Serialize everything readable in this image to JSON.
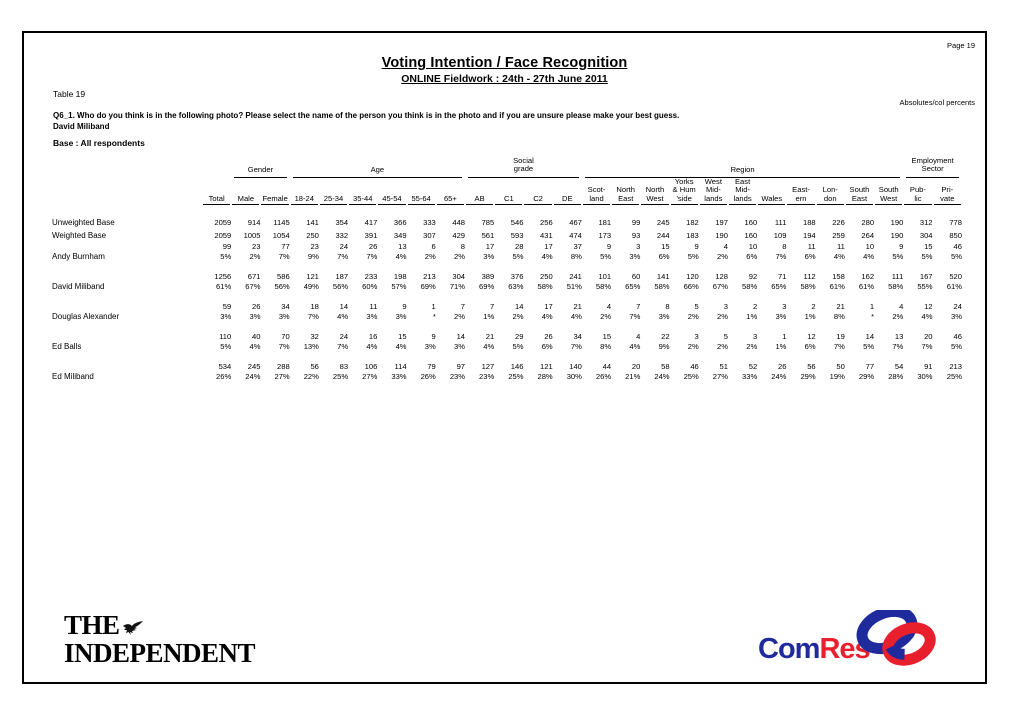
{
  "page": {
    "page_number": "Page 19",
    "notes": "Absolutes/col percents",
    "title": "Voting Intention / Face Recognition",
    "subtitle": "ONLINE Fieldwork : 24th - 27th June 2011",
    "table_label": "Table 19",
    "question": "Q6_1. Who do you think is in the following photo? Please select the name of the person you think is in the photo and if you are unsure please make your best guess.",
    "question_subject": "David Miliband",
    "base": "Base : All respondents"
  },
  "logos": {
    "independent_line1": "THE",
    "independent_line2": "INDEPENDENT",
    "comres_com": "Com",
    "comres_res": "Res",
    "comres_blue": "#1f2a9c",
    "comres_red": "#e8202e"
  },
  "table": {
    "groups": [
      {
        "label": "",
        "span": 1
      },
      {
        "label": "Gender",
        "span": 2
      },
      {
        "label": "Age",
        "span": 6
      },
      {
        "label": "Social grade",
        "span": 4
      },
      {
        "label": "Region",
        "span": 11
      },
      {
        "label": "Employment Sector",
        "span": 2
      }
    ],
    "columns": [
      {
        "id": "total",
        "l1": "",
        "l2": "",
        "l3": "Total"
      },
      {
        "id": "male",
        "l1": "",
        "l2": "",
        "l3": "Male"
      },
      {
        "id": "female",
        "l1": "",
        "l2": "",
        "l3": "Female"
      },
      {
        "id": "a1824",
        "l1": "",
        "l2": "",
        "l3": "18-24"
      },
      {
        "id": "a2534",
        "l1": "",
        "l2": "",
        "l3": "25-34"
      },
      {
        "id": "a3544",
        "l1": "",
        "l2": "",
        "l3": "35-44"
      },
      {
        "id": "a4554",
        "l1": "",
        "l2": "",
        "l3": "45-54"
      },
      {
        "id": "a5564",
        "l1": "",
        "l2": "",
        "l3": "55-64"
      },
      {
        "id": "a65",
        "l1": "",
        "l2": "",
        "l3": "65+"
      },
      {
        "id": "ab",
        "l1": "",
        "l2": "",
        "l3": "AB"
      },
      {
        "id": "c1",
        "l1": "",
        "l2": "",
        "l3": "C1"
      },
      {
        "id": "c2",
        "l1": "",
        "l2": "",
        "l3": "C2"
      },
      {
        "id": "de",
        "l1": "",
        "l2": "",
        "l3": "DE"
      },
      {
        "id": "scot",
        "l1": "",
        "l2": "Scot-",
        "l3": "land"
      },
      {
        "id": "ne",
        "l1": "",
        "l2": "North",
        "l3": "East"
      },
      {
        "id": "nw",
        "l1": "",
        "l2": "North",
        "l3": "West"
      },
      {
        "id": "yorks",
        "l1": "Yorks",
        "l2": "& Hum",
        "l3": "'side"
      },
      {
        "id": "wmid",
        "l1": "West",
        "l2": "Mid-",
        "l3": "lands"
      },
      {
        "id": "emid",
        "l1": "East",
        "l2": "Mid-",
        "l3": "lands"
      },
      {
        "id": "wales",
        "l1": "",
        "l2": "",
        "l3": "Wales"
      },
      {
        "id": "eastern",
        "l1": "",
        "l2": "East-",
        "l3": "ern"
      },
      {
        "id": "london",
        "l1": "",
        "l2": "Lon-",
        "l3": "don"
      },
      {
        "id": "se",
        "l1": "",
        "l2": "South",
        "l3": "East"
      },
      {
        "id": "sw",
        "l1": "",
        "l2": "South",
        "l3": "West"
      },
      {
        "id": "public",
        "l1": "",
        "l2": "Pub-",
        "l3": "lic"
      },
      {
        "id": "private",
        "l1": "",
        "l2": "Pri-",
        "l3": "vate"
      }
    ],
    "rows": [
      {
        "label": "Unweighted Base",
        "type": "base",
        "counts": [
          "2059",
          "914",
          "1145",
          "141",
          "354",
          "417",
          "366",
          "333",
          "448",
          "785",
          "546",
          "256",
          "467",
          "181",
          "99",
          "245",
          "182",
          "197",
          "160",
          "111",
          "188",
          "226",
          "280",
          "190",
          "312",
          "778"
        ]
      },
      {
        "label": "Weighted Base",
        "type": "base",
        "counts": [
          "2059",
          "1005",
          "1054",
          "250",
          "332",
          "391",
          "349",
          "307",
          "429",
          "561",
          "593",
          "431",
          "474",
          "173",
          "93",
          "244",
          "183",
          "190",
          "160",
          "109",
          "194",
          "259",
          "264",
          "190",
          "304",
          "850"
        ]
      },
      {
        "label": "Andy Burnham",
        "type": "data",
        "counts": [
          "99",
          "23",
          "77",
          "23",
          "24",
          "26",
          "13",
          "6",
          "8",
          "17",
          "28",
          "17",
          "37",
          "9",
          "3",
          "15",
          "9",
          "4",
          "10",
          "8",
          "11",
          "11",
          "10",
          "9",
          "15",
          "46"
        ],
        "pcts": [
          "5%",
          "2%",
          "7%",
          "9%",
          "7%",
          "7%",
          "4%",
          "2%",
          "2%",
          "3%",
          "5%",
          "4%",
          "8%",
          "5%",
          "3%",
          "6%",
          "5%",
          "2%",
          "6%",
          "7%",
          "6%",
          "4%",
          "4%",
          "5%",
          "5%",
          "5%"
        ]
      },
      {
        "label": "David Miliband",
        "type": "data",
        "counts": [
          "1256",
          "671",
          "586",
          "121",
          "187",
          "233",
          "198",
          "213",
          "304",
          "389",
          "376",
          "250",
          "241",
          "101",
          "60",
          "141",
          "120",
          "128",
          "92",
          "71",
          "112",
          "158",
          "162",
          "111",
          "167",
          "520"
        ],
        "pcts": [
          "61%",
          "67%",
          "56%",
          "49%",
          "56%",
          "60%",
          "57%",
          "69%",
          "71%",
          "69%",
          "63%",
          "58%",
          "51%",
          "58%",
          "65%",
          "58%",
          "66%",
          "67%",
          "58%",
          "65%",
          "58%",
          "61%",
          "61%",
          "58%",
          "55%",
          "61%"
        ]
      },
      {
        "label": "Douglas Alexander",
        "type": "data",
        "counts": [
          "59",
          "26",
          "34",
          "18",
          "14",
          "11",
          "9",
          "1",
          "7",
          "7",
          "14",
          "17",
          "21",
          "4",
          "7",
          "8",
          "5",
          "3",
          "2",
          "3",
          "2",
          "21",
          "1",
          "4",
          "12",
          "24"
        ],
        "pcts": [
          "3%",
          "3%",
          "3%",
          "7%",
          "4%",
          "3%",
          "3%",
          "*",
          "2%",
          "1%",
          "2%",
          "4%",
          "4%",
          "2%",
          "7%",
          "3%",
          "2%",
          "2%",
          "1%",
          "3%",
          "1%",
          "8%",
          "*",
          "2%",
          "4%",
          "3%"
        ]
      },
      {
        "label": "Ed Balls",
        "type": "data",
        "counts": [
          "110",
          "40",
          "70",
          "32",
          "24",
          "16",
          "15",
          "9",
          "14",
          "21",
          "29",
          "26",
          "34",
          "15",
          "4",
          "22",
          "3",
          "5",
          "3",
          "1",
          "12",
          "19",
          "14",
          "13",
          "20",
          "46"
        ],
        "pcts": [
          "5%",
          "4%",
          "7%",
          "13%",
          "7%",
          "4%",
          "4%",
          "3%",
          "3%",
          "4%",
          "5%",
          "6%",
          "7%",
          "8%",
          "4%",
          "9%",
          "2%",
          "2%",
          "2%",
          "1%",
          "6%",
          "7%",
          "5%",
          "7%",
          "7%",
          "5%"
        ]
      },
      {
        "label": "Ed Miliband",
        "type": "data",
        "counts": [
          "534",
          "245",
          "288",
          "56",
          "83",
          "106",
          "114",
          "79",
          "97",
          "127",
          "146",
          "121",
          "140",
          "44",
          "20",
          "58",
          "46",
          "51",
          "52",
          "26",
          "56",
          "50",
          "77",
          "54",
          "91",
          "213"
        ],
        "pcts": [
          "26%",
          "24%",
          "27%",
          "22%",
          "25%",
          "27%",
          "33%",
          "26%",
          "23%",
          "23%",
          "25%",
          "28%",
          "30%",
          "26%",
          "21%",
          "24%",
          "25%",
          "27%",
          "33%",
          "24%",
          "29%",
          "19%",
          "29%",
          "28%",
          "30%",
          "25%"
        ]
      }
    ]
  }
}
